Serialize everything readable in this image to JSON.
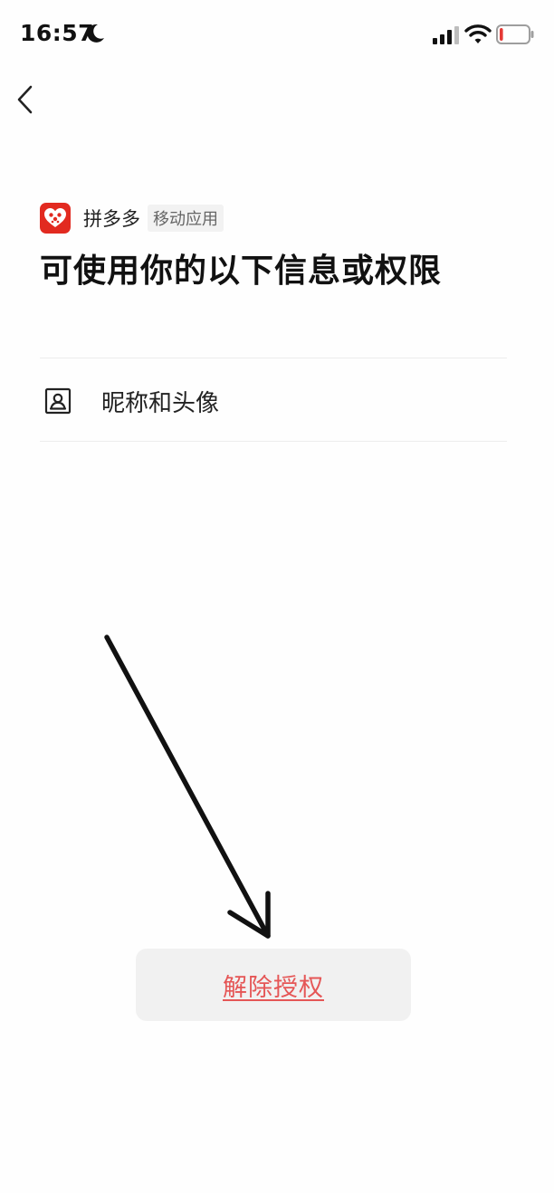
{
  "status_bar": {
    "time": "16:57",
    "moon_icon": "moon-icon",
    "signal_icon": "cellular-signal-icon",
    "wifi_icon": "wifi-icon",
    "battery_icon": "battery-low-icon",
    "battery_level": 0.12,
    "battery_color": "#e53935"
  },
  "nav": {
    "back_icon": "chevron-left-icon"
  },
  "app": {
    "name": "拼多多",
    "tag": "移动应用",
    "logo_icon": "pinduoduo-logo",
    "logo_color": "#e22a20"
  },
  "title": "可使用你的以下信息或权限",
  "permissions": [
    {
      "icon": "user-portrait-icon",
      "label": "昵称和头像"
    }
  ],
  "actions": {
    "revoke_label": "解除授权",
    "revoke_color": "#e55656"
  }
}
